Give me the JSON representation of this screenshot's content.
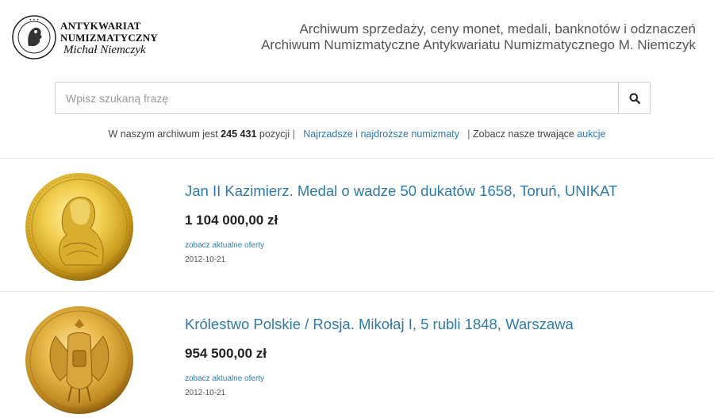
{
  "logo": {
    "line1": "ANTYKWARIAT",
    "line2": "NUMIZMATYCZNY",
    "line3": "Michał Niemczyk"
  },
  "header": {
    "title_line1": "Archiwum sprzedaży, ceny monet, medali, banknotów i odznaczeń",
    "title_line2": "Archiwum Numizmatyczne Antykwariatu Numizmatycznego M. Niemczyk"
  },
  "search": {
    "placeholder": "Wpisz szukaną frazę",
    "value": "",
    "button_icon": "search-icon"
  },
  "stats": {
    "prefix": "W naszym archiwum jest",
    "count": "245 431",
    "suffix": "pozycji",
    "sep1": "|",
    "link_label": "Najrzadsze i najdroższe numizmaty",
    "sep2": "|",
    "auctions_prefix": "Zobacz nasze trwające",
    "auctions_link": "aukcje"
  },
  "items": [
    {
      "title": "Jan II Kazimierz. Medal o wadze 50 dukatów 1658, Toruń, UNIKAT",
      "price": "1 104 000,00 zł",
      "offers_label": "zobacz aktualne oferty",
      "date": "2012-10-21",
      "image_icon": "gold-medal-portrait-icon"
    },
    {
      "title": "Królestwo Polskie / Rosja. Mikołaj I, 5 rubli 1848, Warszawa",
      "price": "954 500,00 zł",
      "offers_label": "zobacz aktualne oferty",
      "date": "2012-10-21",
      "image_icon": "gold-coin-eagle-icon"
    }
  ],
  "colors": {
    "link": "#2e7ba8",
    "gold_light": "#f6dc6a",
    "gold_dark": "#b8860b"
  }
}
